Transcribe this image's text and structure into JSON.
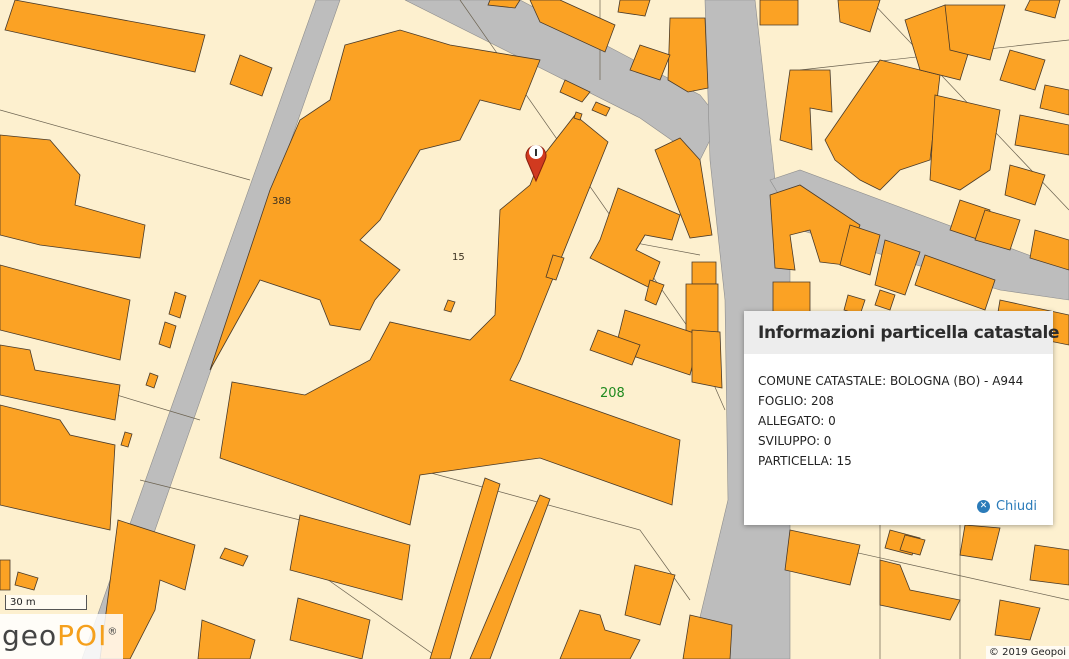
{
  "map": {
    "parcel_labels": {
      "p388": "388",
      "p15": "15"
    },
    "sheet_label": "208",
    "marker_glyph": "I"
  },
  "popup": {
    "title": "Informazioni particella catastale",
    "lines": [
      "COMUNE CATASTALE: BOLOGNA (BO) - A944",
      "FOGLIO: 208",
      "ALLEGATO: 0",
      "SVILUPPO: 0",
      "PARTICELLA: 15"
    ],
    "close_label": "Chiudi"
  },
  "scale": {
    "label": "30 m"
  },
  "logo": {
    "prefix": "geo",
    "suffix": "POI",
    "mark": "®"
  },
  "attribution": "© 2019 Geopoi",
  "colors": {
    "building": "#fba224",
    "land": "#fdf0cf",
    "road": "#bdbdbd",
    "marker": "#d13a1f",
    "link": "#2b7bb9"
  }
}
